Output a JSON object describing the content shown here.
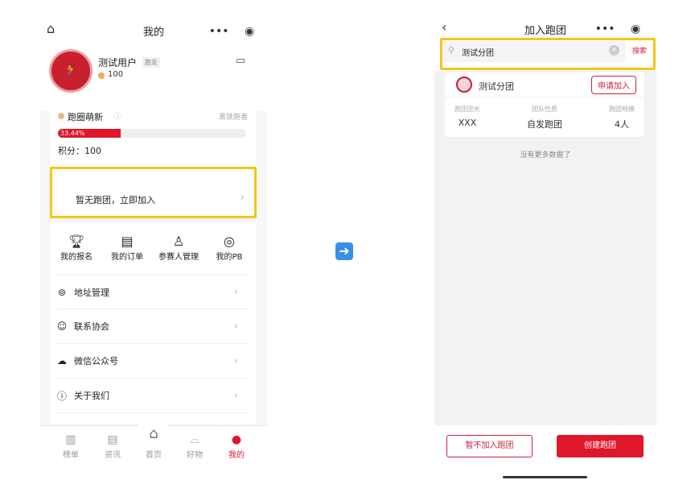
{
  "left": {
    "header": {
      "title": "我的",
      "home_icon": "home-icon",
      "more_icon": "more-dots-icon",
      "target_icon": "target-icon"
    },
    "profile": {
      "name": "测试用户",
      "badge": "跑友",
      "points": "100",
      "message_icon": "message-icon"
    },
    "level": {
      "title": "跑圈萌新",
      "rank": "黑铁跑者",
      "progress_label": "33.44%",
      "progress": 33.44,
      "score": "积分：100"
    },
    "join_prompt": "暂无跑团，立即加入",
    "grid": [
      {
        "label": "我的报名",
        "icon": "trophy-icon"
      },
      {
        "label": "我的订单",
        "icon": "order-icon"
      },
      {
        "label": "参赛人管理",
        "icon": "user-icon"
      },
      {
        "label": "我的PB",
        "icon": "medal-icon"
      }
    ],
    "menu": [
      {
        "label": "地址管理",
        "icon": "location-icon"
      },
      {
        "label": "联系协会",
        "icon": "contacts-icon"
      },
      {
        "label": "微信公众号",
        "icon": "wechat-icon"
      },
      {
        "label": "关于我们",
        "icon": "info-icon"
      }
    ],
    "tabs": [
      {
        "label": "榜单"
      },
      {
        "label": "资讯"
      },
      {
        "label": "首页"
      },
      {
        "label": "好物"
      },
      {
        "label": "我的",
        "active": true
      }
    ]
  },
  "right": {
    "header": {
      "title": "加入跑团"
    },
    "search": {
      "value": "测试分团",
      "button": "搜索"
    },
    "result": {
      "name": "测试分团",
      "apply": "申请加入",
      "fields": [
        {
          "label": "跑团团长",
          "value": "XXX"
        },
        {
          "label": "团队性质",
          "value": "自发跑团"
        },
        {
          "label": "跑团规模",
          "value": "4人"
        }
      ]
    },
    "no_more": "没有更多数据了",
    "buttons": {
      "skip": "暂不加入跑团",
      "create": "创建跑团"
    }
  },
  "colors": {
    "accent": "#e0162b",
    "highlight": "#f5c518"
  }
}
